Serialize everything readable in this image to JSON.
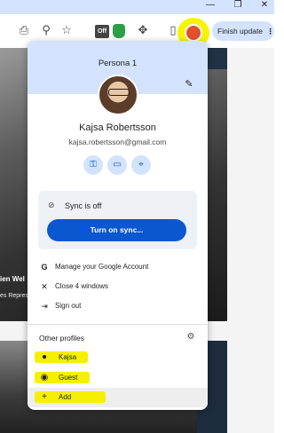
{
  "titlebar": {
    "minimize_icon": "minimize-icon",
    "restore_icon": "restore-icon",
    "close_icon": "close-icon",
    "minimize": "—",
    "restore": "❐",
    "close": "✕"
  },
  "toolbar": {
    "icons": [
      "install-app-icon",
      "zoom-icon",
      "bookmark-star-icon",
      "extension-off-icon",
      "extension-green-icon",
      "extensions-puzzle-icon",
      "side-panel-icon",
      "profile-icon"
    ],
    "off_badge": "Off",
    "finish_update_label": "Finish update",
    "menu_icon": "⋮"
  },
  "background_page": {
    "text_line_1": "ien Wel",
    "text_line_2": "es Repres"
  },
  "profile_menu": {
    "profile_title": "Persona 1",
    "name": "Kajsa Robertsson",
    "email": "kajsa.robertsson@gmail.com",
    "quick_actions": [
      "passwords-key-icon",
      "payment-card-icon",
      "addresses-pin-icon"
    ],
    "sync_status": "Sync is off",
    "sync_button_label": "Turn on sync...",
    "menu_items": [
      {
        "icon": "google-g-icon",
        "label": "Manage your Google Account"
      },
      {
        "icon": "close-icon",
        "label": "Close 4 windows"
      },
      {
        "icon": "sign-out-icon",
        "label": "Sign out"
      }
    ],
    "other_profiles_label": "Other profiles",
    "profiles": [
      {
        "icon": "person-icon",
        "label": "Kajsa"
      },
      {
        "icon": "guest-icon",
        "label": "Guest"
      },
      {
        "icon": "add-icon",
        "label": "Add"
      }
    ],
    "highlight_color": "#f6f000",
    "accent_color": "#0b57d0",
    "header_color": "#d3e3fd"
  }
}
